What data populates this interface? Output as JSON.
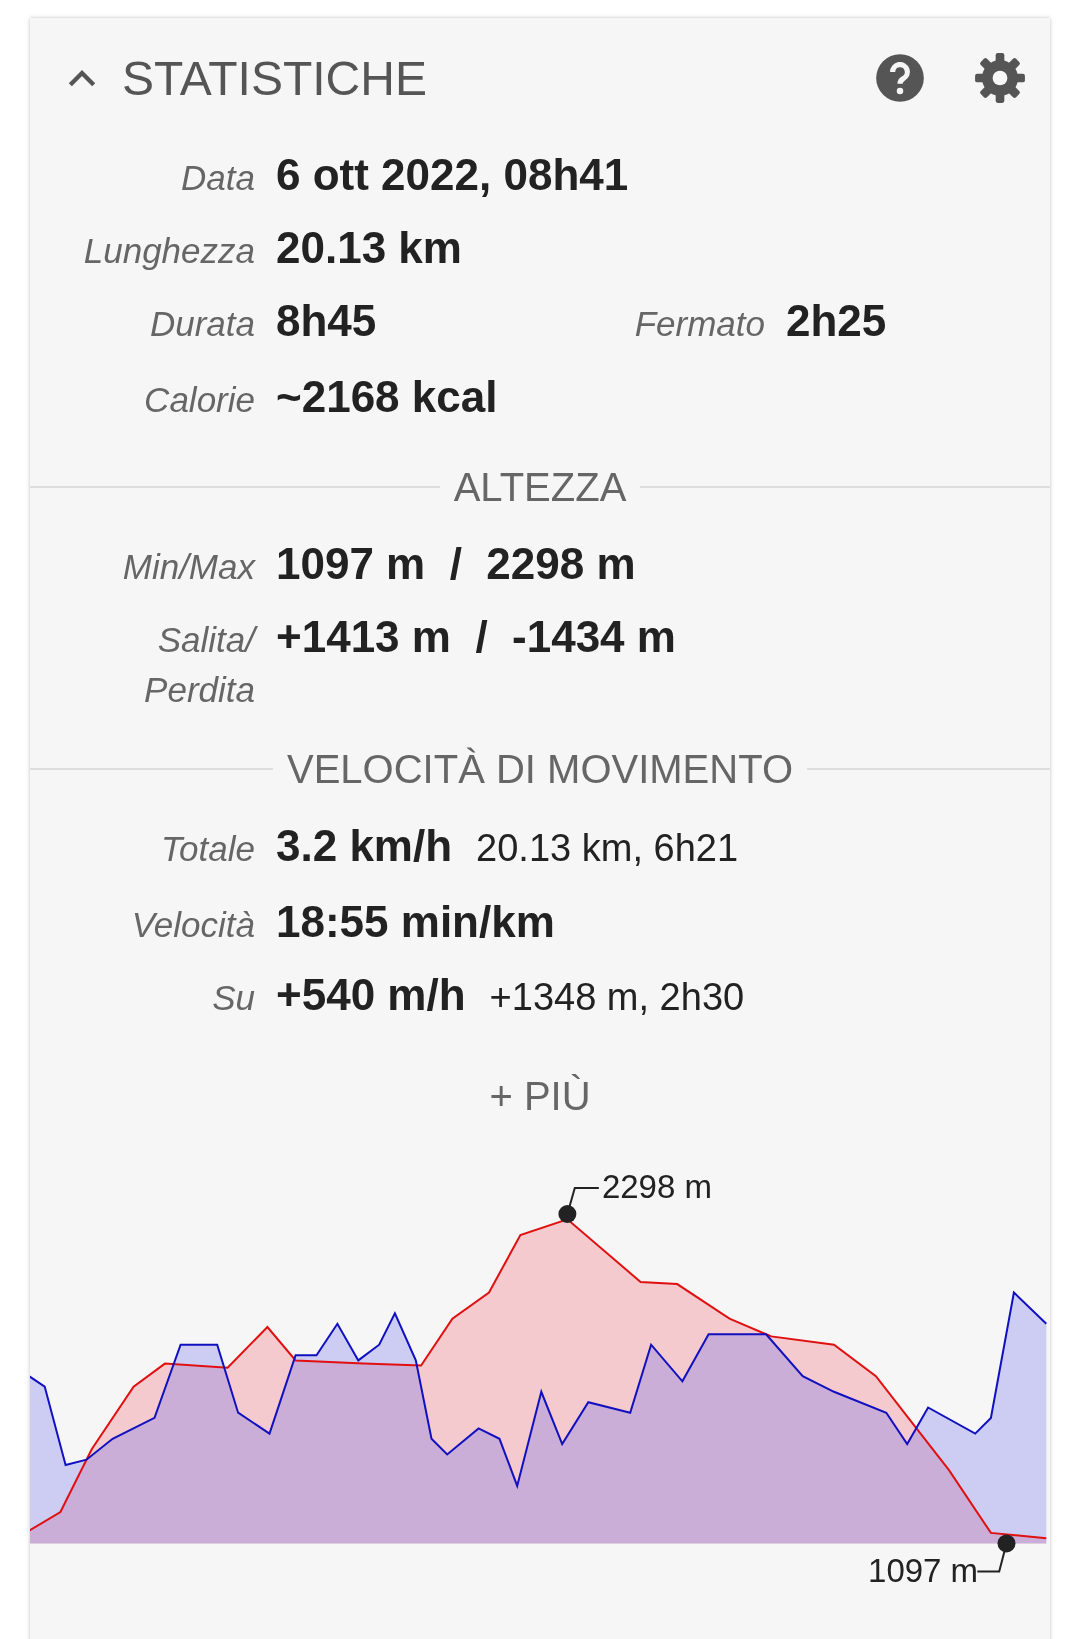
{
  "header": {
    "title": "STATISTICHE",
    "expanded": true
  },
  "summary": [
    {
      "label": "Data",
      "value": "6 ott 2022, 08h41"
    },
    {
      "label": "Lunghezza",
      "value": "20.13 km"
    },
    {
      "label": "Durata",
      "value": "8h45",
      "extra_label": "Fermato",
      "extra_value": "2h25"
    },
    {
      "label": "Calorie",
      "value": "~2168 kcal"
    }
  ],
  "sections": [
    {
      "title": "ALTEZZA",
      "rows": [
        {
          "label": "Min/Max",
          "value": "1097 m  /  2298 m"
        },
        {
          "label": "Salita/ Perdita",
          "value": "+1413 m  /  -1434 m"
        }
      ]
    },
    {
      "title": "VELOCITÀ DI MOVIMENTO",
      "rows": [
        {
          "label": "Totale",
          "value": "3.2 km/h",
          "detail": "20.13 km, 6h21"
        },
        {
          "label": "Velocità",
          "value": "18:55 min/km"
        },
        {
          "label": "Su",
          "value": "+540 m/h",
          "detail": "+1348 m, 2h30"
        }
      ]
    }
  ],
  "more_button": "+ PIÙ",
  "elevation_chart": {
    "max_label": "2298 m",
    "min_label": "1097 m"
  }
}
